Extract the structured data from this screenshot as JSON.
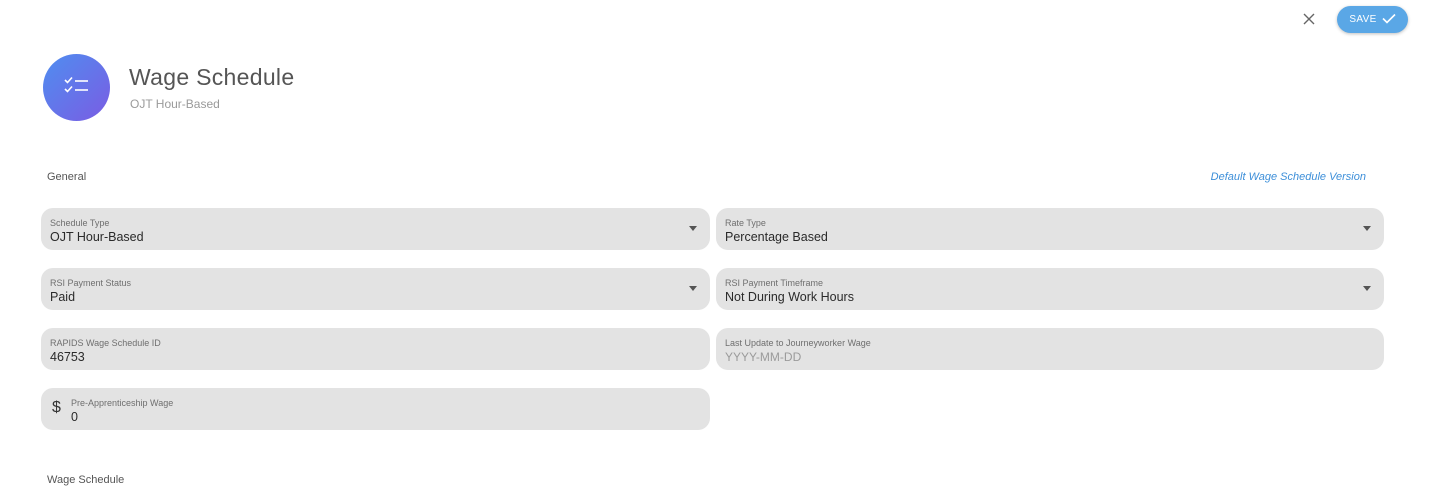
{
  "header": {
    "title": "Wage Schedule",
    "subtitle": "OJT Hour-Based",
    "avatar_icon": "checklist-icon"
  },
  "actions": {
    "close_icon": "close-icon",
    "save_label": "SAVE",
    "save_icon": "check-icon"
  },
  "colors": {
    "accent": "#5aa7e6",
    "link": "#3d8fd9",
    "avatar_gradient_start": "#4f8ef0",
    "avatar_gradient_end": "#7a5ce3",
    "field_bg": "#e3e3e3"
  },
  "general": {
    "section_label": "General",
    "version_link": "Default Wage Schedule Version",
    "schedule_type": {
      "label": "Schedule Type",
      "value": "OJT Hour-Based"
    },
    "rate_type": {
      "label": "Rate Type",
      "value": "Percentage Based"
    },
    "rsi_payment_status": {
      "label": "RSI Payment Status",
      "value": "Paid"
    },
    "rsi_payment_timeframe": {
      "label": "RSI Payment Timeframe",
      "value": "Not During Work Hours"
    },
    "rapids_id": {
      "label": "RAPIDS Wage Schedule ID",
      "value": "46753"
    },
    "last_update": {
      "label": "Last Update to Journeyworker Wage",
      "value": "",
      "placeholder": "YYYY-MM-DD"
    },
    "pre_apprenticeship_wage": {
      "label": "Pre-Apprenticeship Wage",
      "value": "0",
      "prefix": "$"
    }
  },
  "wage_schedule": {
    "section_label": "Wage Schedule"
  }
}
